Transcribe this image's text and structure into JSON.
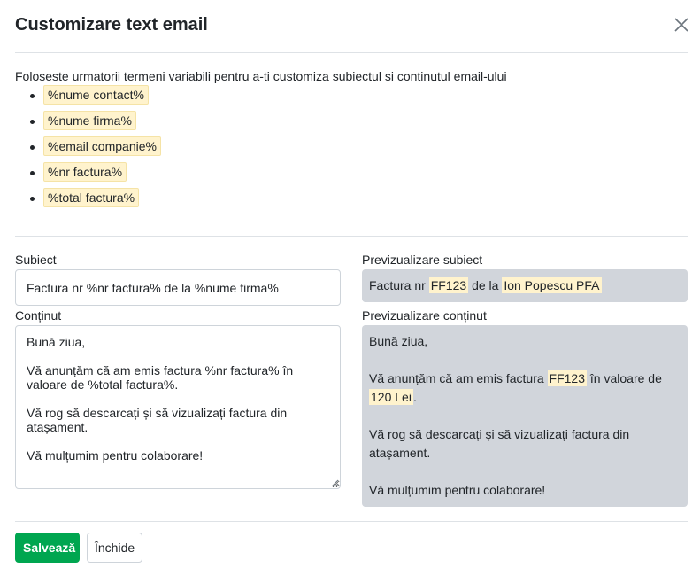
{
  "dialog": {
    "title": "Customizare text email",
    "intro": "Foloseste urmatorii termeni variabili pentru a-ti customiza subiectul si continutul email-ului",
    "variables": [
      "%nume contact%",
      "%nume firma%",
      "%email companie%",
      "%nr factura%",
      "%total factura%"
    ]
  },
  "form": {
    "subject_label": "Subiect",
    "subject_value": "Factura nr %nr factura% de la %nume firma%",
    "content_label": "Conținut",
    "content_value": "Bună ziua,\n\nVă anunțăm că am emis factura %nr factura% în\nvaloare de %total factura%.\n\nVă rog să descarcați și să vizualizați factura din\natașament.\n\nVă mulțumim pentru colaborare!"
  },
  "preview": {
    "subject_label": "Previzualizare subiect",
    "subject": {
      "prefix": "Factura nr",
      "nr": "FF123",
      "mid": "de la",
      "firma": "Ion Popescu PFA"
    },
    "content_label": "Previzualizare conținut",
    "content": {
      "greeting": "Bună ziua,",
      "line1_prefix": "Vă anunțăm că am emis factura",
      "nr": "FF123",
      "line1_suffix": "în valoare de",
      "total": "120 Lei",
      "line2_suffix": ".",
      "line3": "Vă rog să descarcați și să vizualizați factura din",
      "line4": "atașament.",
      "line5": "Vă mulțumim pentru colaborare!"
    }
  },
  "footer": {
    "save_label": "Salvează",
    "close_label": "Închide"
  },
  "colors": {
    "save_button": "#00a650",
    "highlight": "#fff3cd",
    "preview_bg": "#d1d5db"
  },
  "icons": {
    "close": "close-icon"
  }
}
